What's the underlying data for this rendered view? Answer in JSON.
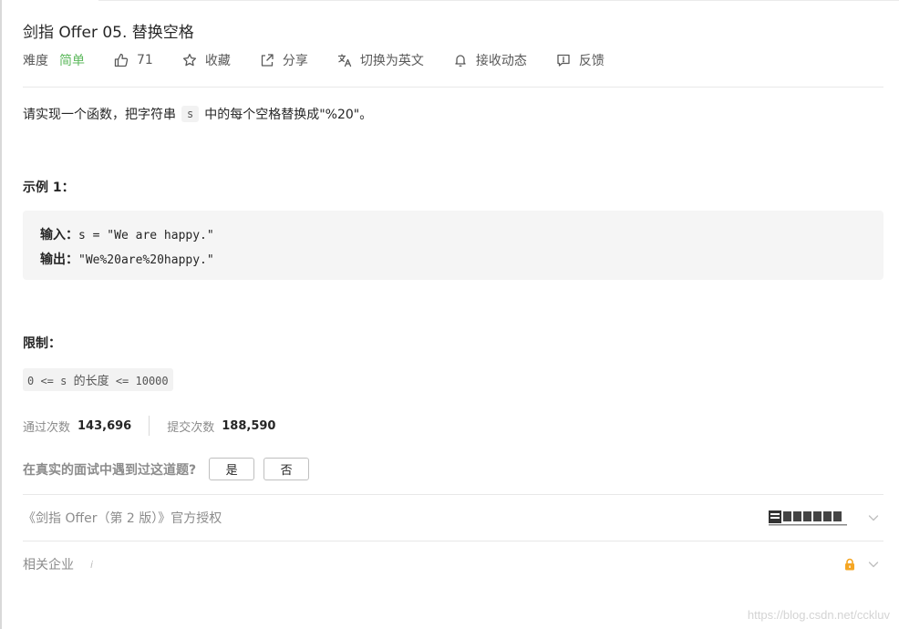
{
  "problem": {
    "title": "剑指 Offer 05. 替换空格",
    "difficulty_label": "难度",
    "difficulty_value": "简单",
    "likes": "71",
    "favorite_label": "收藏",
    "share_label": "分享",
    "switch_lang_label": "切换为英文",
    "subscribe_label": "接收动态",
    "feedback_label": "反馈"
  },
  "description": {
    "before": "请实现一个函数，把字符串",
    "code": "s",
    "after": "中的每个空格替换成\"%20\"。"
  },
  "example": {
    "heading": "示例 1：",
    "input_label": "输入：",
    "input_value": "s = \"We are happy.\"",
    "output_label": "输出：",
    "output_value": "\"We%20are%20happy.\""
  },
  "limits": {
    "heading": "限制：",
    "before": "0 <= s ",
    "middle": "的长度",
    "after": " <= 10000"
  },
  "stats": {
    "accepted_label": "通过次数",
    "accepted_value": "143,696",
    "submitted_label": "提交次数",
    "submitted_value": "188,590"
  },
  "interview": {
    "question": "在真实的面试中遇到过这道题?",
    "yes_label": "是",
    "no_label": "否"
  },
  "sections": {
    "license_label": "《剑指 Offer（第 2 版）》官方授权",
    "companies_label": "相关企业",
    "companies_info": "i"
  },
  "watermark": "https://blog.csdn.net/cckluv",
  "colors": {
    "easy": "#5cb85c",
    "lock": "#f5a623",
    "text": "#262626",
    "muted": "#8c8c8c"
  },
  "icons": {
    "like": "thumbs-up-icon",
    "favorite": "star-icon",
    "share": "share-icon",
    "translate": "translate-icon",
    "bell": "bell-icon",
    "feedback": "feedback-icon",
    "lock": "lock-icon",
    "chevron": "chevron-down-icon",
    "publisher": "publisher-logo"
  }
}
